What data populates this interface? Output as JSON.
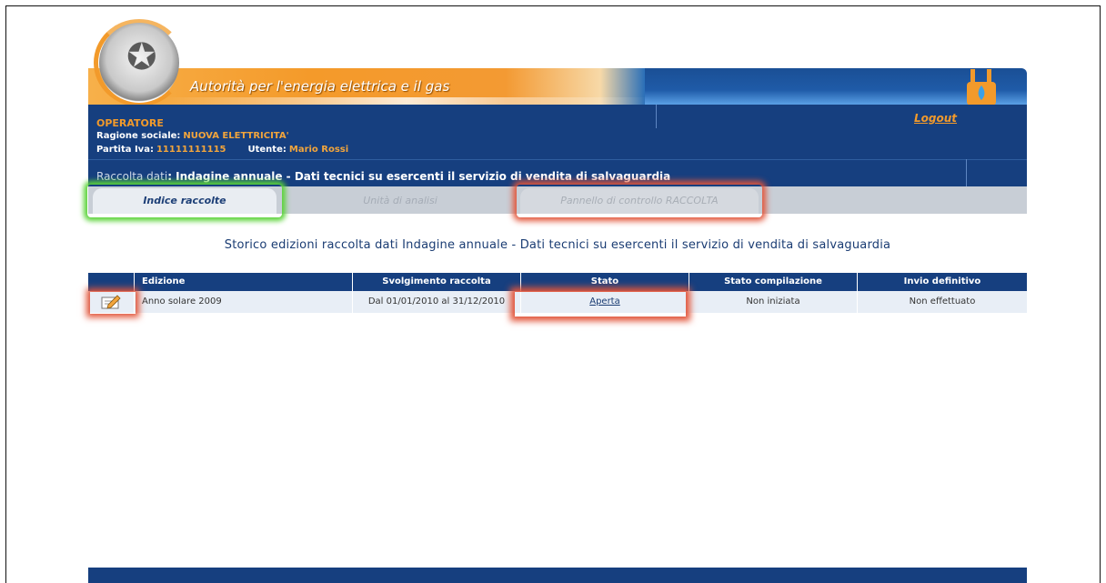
{
  "header": {
    "title": "Autorità per l'energia elettrica e il gas"
  },
  "operator": {
    "title": "OPERATORE",
    "ragione_label": "Ragione sociale:",
    "ragione_value": "NUOVA ELETTRICITA'",
    "piva_label": "Partita Iva:",
    "piva_value": "11111111115",
    "utente_label": "Utente:",
    "utente_value": "Mario Rossi",
    "logout": "Logout"
  },
  "raccolta": {
    "prefix": "Raccolta dati",
    "text": ": Indagine annuale - Dati tecnici su esercenti il servizio di vendita di salvaguardia"
  },
  "tabs": [
    {
      "label": "Indice raccolte",
      "active": true
    },
    {
      "label": "Unità di analisi",
      "active": false
    },
    {
      "label": "Pannello di controllo RACCOLTA",
      "active": false
    }
  ],
  "page_title": "Storico edizioni raccolta dati Indagine annuale - Dati tecnici su esercenti il servizio di vendita di salvaguardia",
  "table": {
    "headers": [
      "Edizione",
      "Svolgimento raccolta",
      "Stato",
      "Stato compilazione",
      "Invio definitivo"
    ],
    "rows": [
      {
        "edizione": "Anno solare 2009",
        "svolgimento": "Dal 01/01/2010 al 31/12/2010",
        "stato": "Aperta",
        "stato_compilazione": "Non iniziata",
        "invio": "Non effettuato"
      }
    ]
  },
  "icons": {
    "edit": "edit-icon",
    "plug": "plug-icon",
    "emblem": "emblem-icon"
  },
  "colors": {
    "primary": "#163f7f",
    "accent": "#f29a2b",
    "highlight_green": "#5bd33a",
    "highlight_red": "#e2553a"
  }
}
